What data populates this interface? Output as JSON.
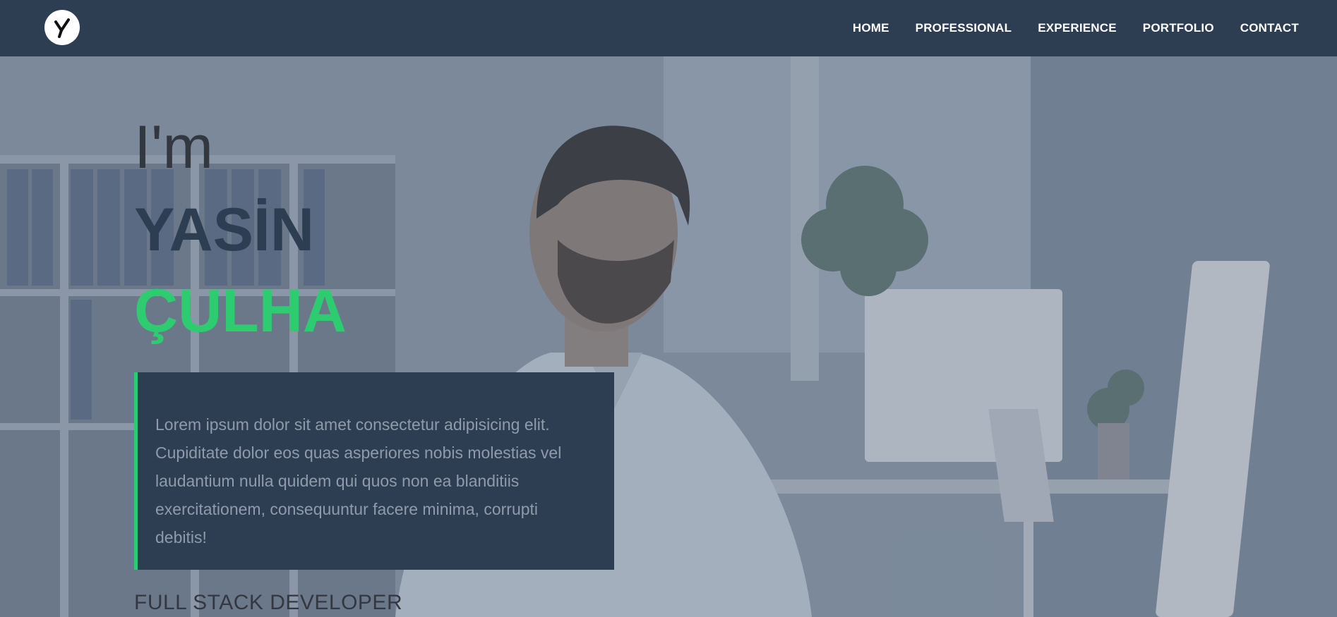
{
  "header": {
    "logo_icon": "y-monogram-icon",
    "nav": [
      {
        "label": "HOME"
      },
      {
        "label": "PROFESSIONAL"
      },
      {
        "label": "EXPERIENCE"
      },
      {
        "label": "PORTFOLIO"
      },
      {
        "label": "CONTACT"
      }
    ]
  },
  "hero": {
    "intro": "I'm",
    "first_name": "YASİN",
    "last_name": "ÇULHA",
    "description": "Lorem ipsum dolor sit amet consectetur adipisicing elit. Cupiditate dolor eos quas asperiores nobis molestias vel laudantium nulla quidem qui quos non ea blanditiis exercitationem, consequuntur facere minima, corrupti debitis!",
    "role": "FULL STACK DEVELOPER"
  },
  "colors": {
    "navbar": "#2e3e52",
    "accent": "#2ecc71",
    "name_primary": "#2e3e52"
  }
}
